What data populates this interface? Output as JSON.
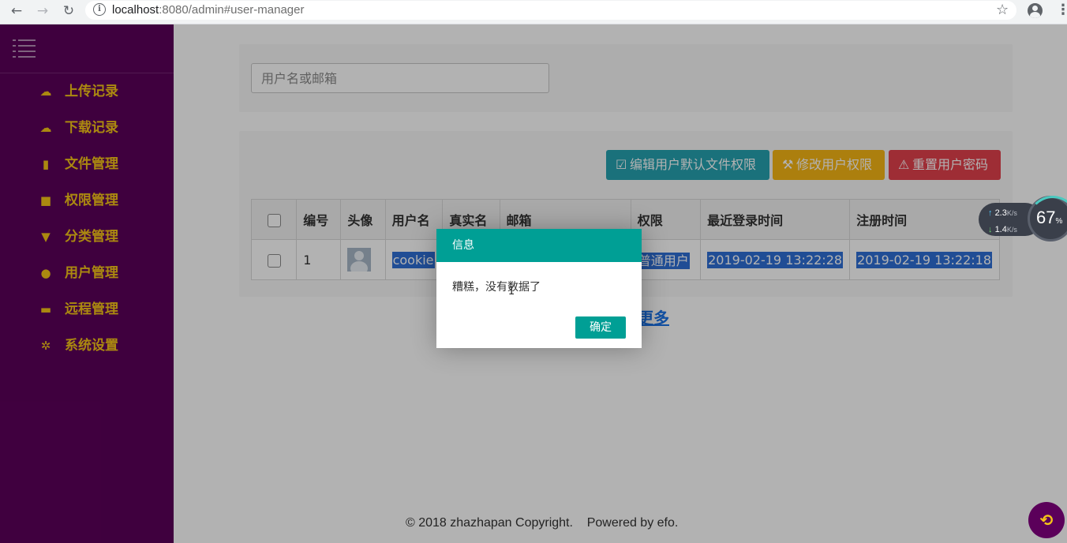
{
  "browser": {
    "url_host": "localhost",
    "url_rest": ":8080/admin#user-manager"
  },
  "sidebar": {
    "items": [
      {
        "label": "上传记录",
        "icon": "cloud-upload-icon"
      },
      {
        "label": "下载记录",
        "icon": "cloud-download-icon"
      },
      {
        "label": "文件管理",
        "icon": "file-icon"
      },
      {
        "label": "权限管理",
        "icon": "lock-icon"
      },
      {
        "label": "分类管理",
        "icon": "filter-icon"
      },
      {
        "label": "用户管理",
        "icon": "user-icon"
      },
      {
        "label": "远程管理",
        "icon": "folder-icon"
      },
      {
        "label": "系统设置",
        "icon": "gear-icon"
      }
    ]
  },
  "search": {
    "placeholder": "用户名或邮箱",
    "value": ""
  },
  "toolbar": {
    "edit_label": "编辑用户默认文件权限",
    "modify_label": "修改用户权限",
    "reset_label": "重置用户密码"
  },
  "table": {
    "headers": [
      "编号",
      "头像",
      "用户名",
      "真实名",
      "邮箱",
      "权限",
      "最近登录时间",
      "注册时间"
    ],
    "rows": [
      {
        "id": "1",
        "username": "cookie",
        "realname": "",
        "email": "",
        "permission": "普通用户",
        "last_login": "2019-02-19 13:22:28",
        "registered": "2019-02-19 13:22:18"
      }
    ]
  },
  "load_more": "更多",
  "footer": "© 2018 zhazhapan Copyright.    Powered by efo.",
  "dialog": {
    "title": "信息",
    "message": "糟糕，没有数据了",
    "ok_label": "确定"
  },
  "speed_widget": {
    "upload": "2.3",
    "download": "1.4",
    "unit": "K/s",
    "percent": "67",
    "percent_sign": "%"
  },
  "colors": {
    "sidebar_bg": "#5b005a",
    "sidebar_text": "#f5c518",
    "dialog_accent": "#009f95",
    "btn_edit": "#26a2b0",
    "btn_modify": "#f7b615",
    "btn_reset": "#e2414c",
    "selection": "#2f6fd6"
  }
}
